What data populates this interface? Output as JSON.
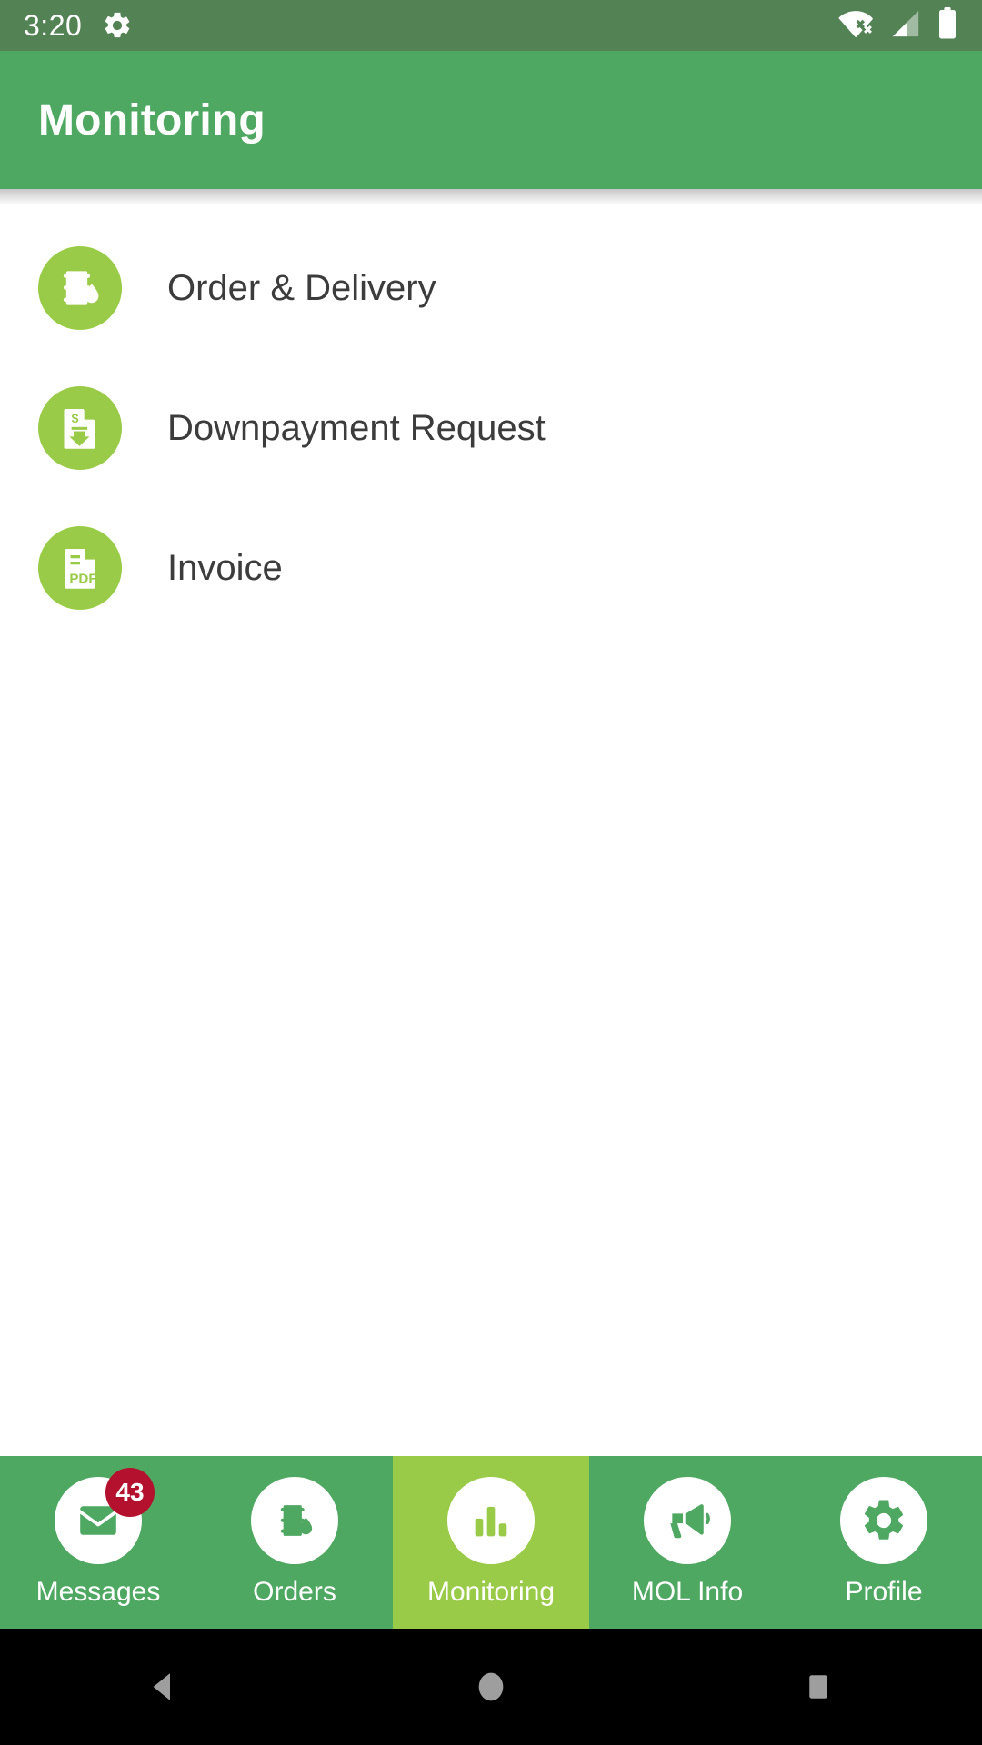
{
  "status_bar": {
    "time": "3:20",
    "icons": [
      "gear-icon",
      "wifi-off-icon",
      "cellular-signal-icon",
      "battery-full-icon"
    ],
    "background": "#538354"
  },
  "app_bar": {
    "title": "Monitoring",
    "background": "#4FA862",
    "text_color": "#FFFFFF"
  },
  "theme": {
    "primary_green": "#4FA862",
    "accent_green": "#9ACB48",
    "status_bar_green": "#538354",
    "badge_red": "#B3112E",
    "body_text": "#3C3C3C"
  },
  "content": {
    "items": [
      {
        "label": "Order & Delivery",
        "icon": "oil-barrel-drop-icon"
      },
      {
        "label": "Downpayment Request",
        "icon": "document-dollar-down-arrow-icon"
      },
      {
        "label": "Invoice",
        "icon": "pdf-document-icon"
      }
    ]
  },
  "bottom_nav": {
    "items": [
      {
        "label": "Messages",
        "icon": "envelope-icon",
        "badge": "43",
        "active": false
      },
      {
        "label": "Orders",
        "icon": "oil-barrel-drop-icon",
        "badge": "",
        "active": false
      },
      {
        "label": "Monitoring",
        "icon": "bar-chart-icon",
        "badge": "",
        "active": true
      },
      {
        "label": "MOL Info",
        "icon": "megaphone-icon",
        "badge": "",
        "active": false
      },
      {
        "label": "Profile",
        "icon": "gear-icon",
        "badge": "",
        "active": false
      }
    ]
  },
  "system_nav": {
    "buttons": [
      "back-button",
      "home-button",
      "recents-button"
    ],
    "background": "#000000",
    "icon_color": "#9E9E9E"
  }
}
